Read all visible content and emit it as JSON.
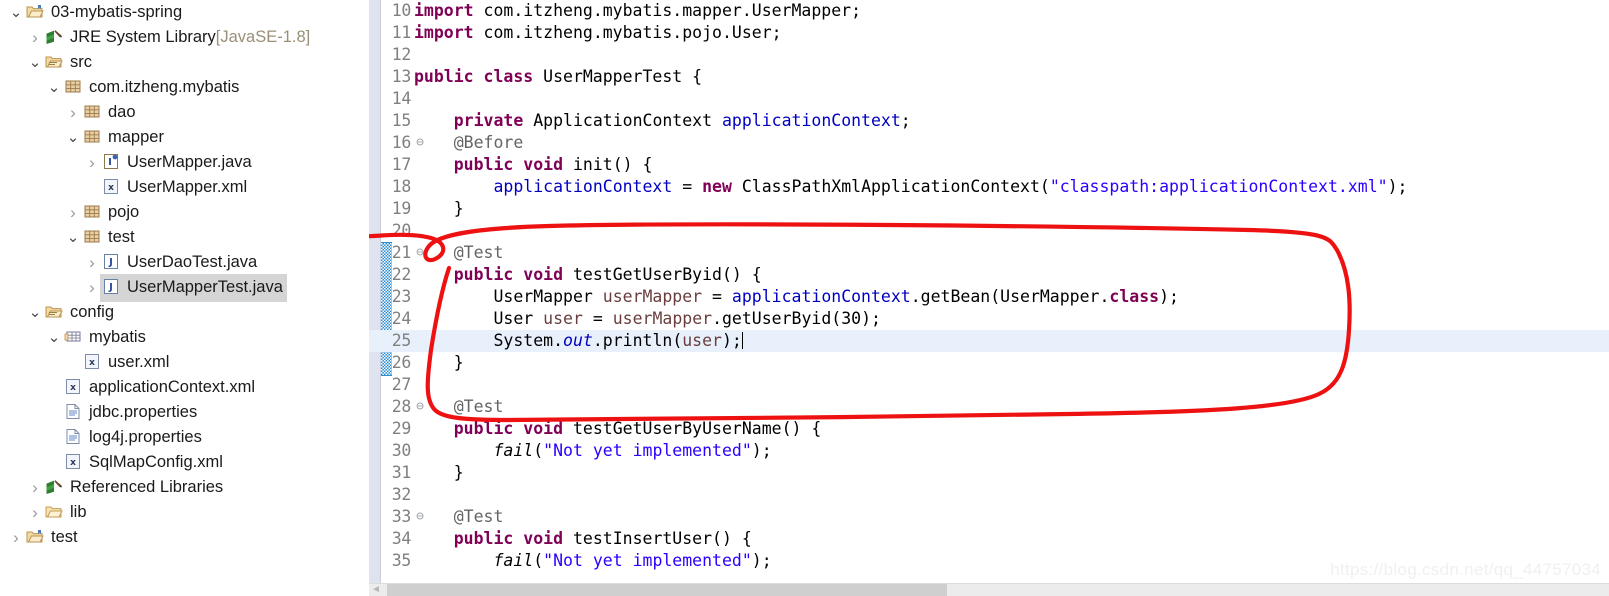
{
  "explorer": {
    "name": "package-explorer",
    "items": [
      {
        "label": "03-mybatis-spring",
        "suffix": "",
        "indent": 0,
        "arrow": "down",
        "icon": "project-folder-icon",
        "selected": false
      },
      {
        "label": "JRE System Library",
        "suffix": " [JavaSE-1.8]",
        "indent": 1,
        "arrow": "right",
        "icon": "library-icon",
        "selected": false
      },
      {
        "label": "src",
        "suffix": "",
        "indent": 1,
        "arrow": "down",
        "icon": "source-folder-icon",
        "selected": false
      },
      {
        "label": "com.itzheng.mybatis",
        "suffix": "",
        "indent": 2,
        "arrow": "down",
        "icon": "package-icon",
        "selected": false
      },
      {
        "label": "dao",
        "suffix": "",
        "indent": 3,
        "arrow": "right",
        "icon": "package-icon",
        "selected": false
      },
      {
        "label": "mapper",
        "suffix": "",
        "indent": 3,
        "arrow": "down",
        "icon": "package-icon",
        "selected": false
      },
      {
        "label": "UserMapper.java",
        "suffix": "",
        "indent": 4,
        "arrow": "right",
        "icon": "java-interface-icon",
        "selected": false
      },
      {
        "label": "UserMapper.xml",
        "suffix": "",
        "indent": 4,
        "arrow": "none",
        "icon": "xml-file-icon",
        "selected": false
      },
      {
        "label": "pojo",
        "suffix": "",
        "indent": 3,
        "arrow": "right",
        "icon": "package-icon",
        "selected": false
      },
      {
        "label": "test",
        "suffix": "",
        "indent": 3,
        "arrow": "down",
        "icon": "package-icon",
        "selected": false
      },
      {
        "label": "UserDaoTest.java",
        "suffix": "",
        "indent": 4,
        "arrow": "right",
        "icon": "java-class-icon",
        "selected": false
      },
      {
        "label": "UserMapperTest.java",
        "suffix": "",
        "indent": 4,
        "arrow": "right",
        "icon": "java-class-icon",
        "selected": true
      },
      {
        "label": "config",
        "suffix": "",
        "indent": 1,
        "arrow": "down",
        "icon": "source-folder-icon",
        "selected": false
      },
      {
        "label": "mybatis",
        "suffix": "",
        "indent": 2,
        "arrow": "down",
        "icon": "folder-package-icon",
        "selected": false
      },
      {
        "label": "user.xml",
        "suffix": "",
        "indent": 3,
        "arrow": "none",
        "icon": "xml-file-icon",
        "selected": false
      },
      {
        "label": "applicationContext.xml",
        "suffix": "",
        "indent": 2,
        "arrow": "none",
        "icon": "xml-file-icon",
        "selected": false
      },
      {
        "label": "jdbc.properties",
        "suffix": "",
        "indent": 2,
        "arrow": "none",
        "icon": "properties-file-icon",
        "selected": false
      },
      {
        "label": "log4j.properties",
        "suffix": "",
        "indent": 2,
        "arrow": "none",
        "icon": "properties-file-icon",
        "selected": false
      },
      {
        "label": "SqlMapConfig.xml",
        "suffix": "",
        "indent": 2,
        "arrow": "none",
        "icon": "xml-file-icon",
        "selected": false
      },
      {
        "label": "Referenced Libraries",
        "suffix": "",
        "indent": 1,
        "arrow": "right",
        "icon": "library-icon",
        "selected": false
      },
      {
        "label": "lib",
        "suffix": "",
        "indent": 1,
        "arrow": "right",
        "icon": "plain-folder-icon",
        "selected": false
      },
      {
        "label": "test",
        "suffix": "",
        "indent": 0,
        "arrow": "right",
        "icon": "project-folder-icon",
        "selected": false
      }
    ]
  },
  "editor": {
    "name": "java-source-editor",
    "first_line_number": 10,
    "current_line": 25,
    "change_bar_from_line": 21,
    "change_bar_to_line": 26,
    "fold_markers": [
      16,
      21,
      28,
      33
    ],
    "lines": [
      {
        "n": 10,
        "tokens": [
          {
            "t": "import ",
            "c": "kw"
          },
          {
            "t": "com.itzheng.mybatis.mapper.UserMapper;",
            "c": "plain"
          }
        ]
      },
      {
        "n": 11,
        "tokens": [
          {
            "t": "import ",
            "c": "kw"
          },
          {
            "t": "com.itzheng.mybatis.pojo.User;",
            "c": "plain"
          }
        ]
      },
      {
        "n": 12,
        "tokens": []
      },
      {
        "n": 13,
        "tokens": [
          {
            "t": "public class ",
            "c": "kw"
          },
          {
            "t": "UserMapperTest {",
            "c": "plain"
          }
        ]
      },
      {
        "n": 14,
        "tokens": []
      },
      {
        "n": 15,
        "tokens": [
          {
            "t": "    ",
            "c": "plain"
          },
          {
            "t": "private ",
            "c": "kw"
          },
          {
            "t": "ApplicationContext ",
            "c": "plain"
          },
          {
            "t": "applicationContext",
            "c": "fld"
          },
          {
            "t": ";",
            "c": "plain"
          }
        ]
      },
      {
        "n": 16,
        "tokens": [
          {
            "t": "    ",
            "c": "plain"
          },
          {
            "t": "@Before",
            "c": "ann"
          }
        ]
      },
      {
        "n": 17,
        "tokens": [
          {
            "t": "    ",
            "c": "plain"
          },
          {
            "t": "public void ",
            "c": "kw"
          },
          {
            "t": "init() {",
            "c": "plain"
          }
        ]
      },
      {
        "n": 18,
        "tokens": [
          {
            "t": "        ",
            "c": "plain"
          },
          {
            "t": "applicationContext",
            "c": "fld"
          },
          {
            "t": " = ",
            "c": "plain"
          },
          {
            "t": "new ",
            "c": "kw"
          },
          {
            "t": "ClassPathXmlApplicationContext(",
            "c": "plain"
          },
          {
            "t": "\"classpath:applicationContext.xml\"",
            "c": "str"
          },
          {
            "t": ");",
            "c": "plain"
          }
        ]
      },
      {
        "n": 19,
        "tokens": [
          {
            "t": "    }",
            "c": "plain"
          }
        ]
      },
      {
        "n": 20,
        "tokens": []
      },
      {
        "n": 21,
        "tokens": [
          {
            "t": "    ",
            "c": "plain"
          },
          {
            "t": "@Test",
            "c": "ann"
          }
        ]
      },
      {
        "n": 22,
        "tokens": [
          {
            "t": "    ",
            "c": "plain"
          },
          {
            "t": "public void ",
            "c": "kw"
          },
          {
            "t": "testGetUserByid() {",
            "c": "plain"
          }
        ]
      },
      {
        "n": 23,
        "tokens": [
          {
            "t": "        ",
            "c": "plain"
          },
          {
            "t": "UserMapper ",
            "c": "plain"
          },
          {
            "t": "userMapper",
            "c": "par"
          },
          {
            "t": " = ",
            "c": "plain"
          },
          {
            "t": "applicationContext",
            "c": "fld"
          },
          {
            "t": ".getBean(UserMapper.",
            "c": "plain"
          },
          {
            "t": "class",
            "c": "kw"
          },
          {
            "t": ");",
            "c": "plain"
          }
        ]
      },
      {
        "n": 24,
        "tokens": [
          {
            "t": "        ",
            "c": "plain"
          },
          {
            "t": "User ",
            "c": "plain"
          },
          {
            "t": "user",
            "c": "par"
          },
          {
            "t": " = ",
            "c": "plain"
          },
          {
            "t": "userMapper",
            "c": "par"
          },
          {
            "t": ".getUserByid(30);",
            "c": "plain"
          }
        ]
      },
      {
        "n": 25,
        "tokens": [
          {
            "t": "        ",
            "c": "plain"
          },
          {
            "t": "System.",
            "c": "plain"
          },
          {
            "t": "out",
            "c": "stat"
          },
          {
            "t": ".println(",
            "c": "plain"
          },
          {
            "t": "user",
            "c": "par"
          },
          {
            "t": ");",
            "c": "plain"
          }
        ],
        "caret": true
      },
      {
        "n": 26,
        "tokens": [
          {
            "t": "    }",
            "c": "plain"
          }
        ]
      },
      {
        "n": 27,
        "tokens": []
      },
      {
        "n": 28,
        "tokens": [
          {
            "t": "    ",
            "c": "plain"
          },
          {
            "t": "@Test",
            "c": "ann"
          }
        ]
      },
      {
        "n": 29,
        "tokens": [
          {
            "t": "    ",
            "c": "plain"
          },
          {
            "t": "public void ",
            "c": "kw"
          },
          {
            "t": "testGetUserByUserName() {",
            "c": "plain"
          }
        ]
      },
      {
        "n": 30,
        "tokens": [
          {
            "t": "        ",
            "c": "plain"
          },
          {
            "t": "fail",
            "c": "meth-it"
          },
          {
            "t": "(",
            "c": "plain"
          },
          {
            "t": "\"Not yet implemented\"",
            "c": "str"
          },
          {
            "t": ");",
            "c": "plain"
          }
        ]
      },
      {
        "n": 31,
        "tokens": [
          {
            "t": "    }",
            "c": "plain"
          }
        ]
      },
      {
        "n": 32,
        "tokens": []
      },
      {
        "n": 33,
        "tokens": [
          {
            "t": "    ",
            "c": "plain"
          },
          {
            "t": "@Test",
            "c": "ann"
          }
        ]
      },
      {
        "n": 34,
        "tokens": [
          {
            "t": "    ",
            "c": "plain"
          },
          {
            "t": "public void ",
            "c": "kw"
          },
          {
            "t": "testInsertUser() {",
            "c": "plain"
          }
        ]
      },
      {
        "n": 35,
        "tokens": [
          {
            "t": "        ",
            "c": "plain"
          },
          {
            "t": "fail",
            "c": "meth-it"
          },
          {
            "t": "(",
            "c": "plain"
          },
          {
            "t": "\"Not yet implemented\"",
            "c": "str"
          },
          {
            "t": ");",
            "c": "plain"
          }
        ]
      }
    ]
  },
  "annotation": {
    "name": "red-hand-drawn-ellipse",
    "color": "#ee1111",
    "description": "hand-drawn red loop enclosing the testGetUserByid test method"
  },
  "watermark": {
    "text": "https://blog.csdn.net/qq_44757034"
  },
  "scrollbar": {
    "name": "horizontal-scrollbar"
  },
  "colors": {
    "keyword": "#7f0055",
    "string": "#2a00ff",
    "field": "#0000c0",
    "annotation_gray": "#646464",
    "parameter": "#6a3e3e",
    "current_line": "#e8f0fb",
    "change_bar": "#2a8fd4",
    "selection": "#d5d5d5",
    "annotation_red": "#ee1111"
  }
}
